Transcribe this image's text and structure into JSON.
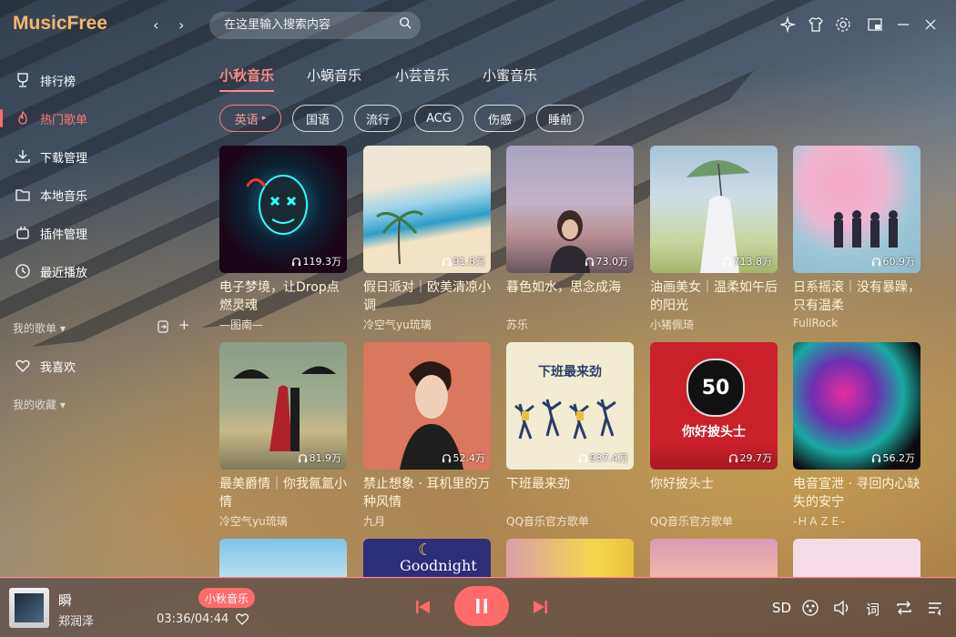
{
  "app": {
    "logo": "MusicFree",
    "back": "‹",
    "forward": "›"
  },
  "search": {
    "placeholder": "在这里输入搜索内容"
  },
  "sidebar": {
    "items": [
      {
        "label": "排行榜",
        "icon": "trophy-icon"
      },
      {
        "label": "热门歌单",
        "icon": "fire-icon",
        "active": true
      },
      {
        "label": "下载管理",
        "icon": "download-icon"
      },
      {
        "label": "本地音乐",
        "icon": "folder-icon"
      },
      {
        "label": "插件管理",
        "icon": "plugin-icon"
      },
      {
        "label": "最近播放",
        "icon": "history-icon"
      }
    ],
    "my_playlists": "我的歌单",
    "favorites": "我喜欢",
    "my_collections": "我的收藏"
  },
  "tabs": [
    "小秋音乐",
    "小蜗音乐",
    "小芸音乐",
    "小蜜音乐"
  ],
  "chips": [
    "英语",
    "国语",
    "流行",
    "ACG",
    "伤感",
    "睡前"
  ],
  "cards": [
    {
      "title": "电子梦境，让Drop点燃灵魂",
      "author": "—图南—",
      "plays": "119.3万"
    },
    {
      "title": "假日派对｜欧美清凉小调",
      "author": "冷空气yu琉璃",
      "plays": "91.8万"
    },
    {
      "title": "暮色如水，思念成海",
      "author": "苏乐",
      "plays": "73.0万"
    },
    {
      "title": "油画美女｜温柔如午后的阳光",
      "author": "小猪佩琦",
      "plays": "713.8万"
    },
    {
      "title": "日系摇滚｜没有暴躁，只有温柔",
      "author": "FullRock",
      "plays": "60.9万"
    },
    {
      "title": "最美爵情｜你我氤氲小情",
      "author": "冷空气yu琉璃",
      "plays": "81.9万"
    },
    {
      "title": "禁止想象 · 耳机里的万种风情",
      "author": "九月",
      "plays": "52.4万"
    },
    {
      "title": "下班最来劲",
      "author": "QQ音乐官方歌单",
      "plays": "937.4万"
    },
    {
      "title": "你好披头士",
      "author": "QQ音乐官方歌单",
      "plays": "29.7万"
    },
    {
      "title": "电音宣泄 · 寻回内心缺失的安宁",
      "author": "-ＨＡＺＥ-",
      "plays": "56.2万"
    }
  ],
  "covers_text": {
    "xiaban": "下班最来劲",
    "beatles": "你好披头士",
    "beatles_num": "50",
    "goodnight": "Goodnight"
  },
  "player": {
    "song": "瞬",
    "artist": "郑润泽",
    "source": "小秋音乐",
    "time": "03:36/04:44",
    "quality": "SD",
    "lyric": "词"
  },
  "colors": {
    "accent": "#ff6b6b",
    "logo": "#f6b76f"
  }
}
